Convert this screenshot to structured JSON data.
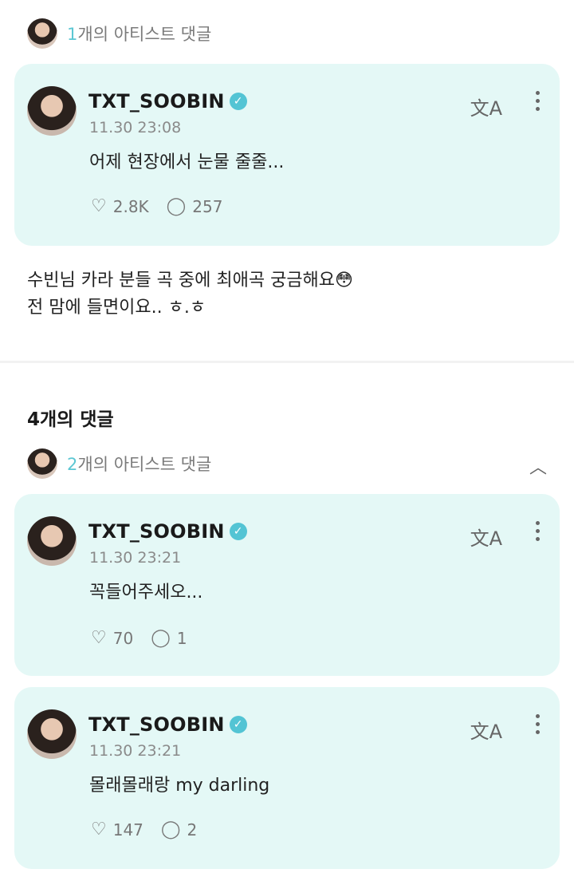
{
  "top_artist": {
    "count": "1",
    "label": "개의 아티스트 댓글"
  },
  "top_card": {
    "name": "TXT_SOOBIN",
    "time": "11.30 23:08",
    "text": "어제 현장에서 눈물 줄줄...",
    "likes": "2.8K",
    "replies": "257"
  },
  "user_comment": {
    "line1": "수빈님 카라 분들 곡 중에 최애곡 궁금해요",
    "emoji": "😳",
    "line2": "전 맘에 들면이요.. ㅎ.ㅎ"
  },
  "comments_title": "4개의 댓글",
  "replies_artist": {
    "count": "2",
    "label": "개의 아티스트 댓글"
  },
  "reply_cards": [
    {
      "name": "TXT_SOOBIN",
      "time": "11.30 23:21",
      "text": "꼭들어주세오...",
      "likes": "70",
      "replies": "1"
    },
    {
      "name": "TXT_SOOBIN",
      "time": "11.30 23:21",
      "text": "몰래몰래랑 my darling",
      "likes": "147",
      "replies": "2"
    }
  ],
  "icons": {
    "translate": "文A",
    "badge": "✓",
    "like": "♡",
    "reply": "◯",
    "chevron_up": "︿"
  }
}
